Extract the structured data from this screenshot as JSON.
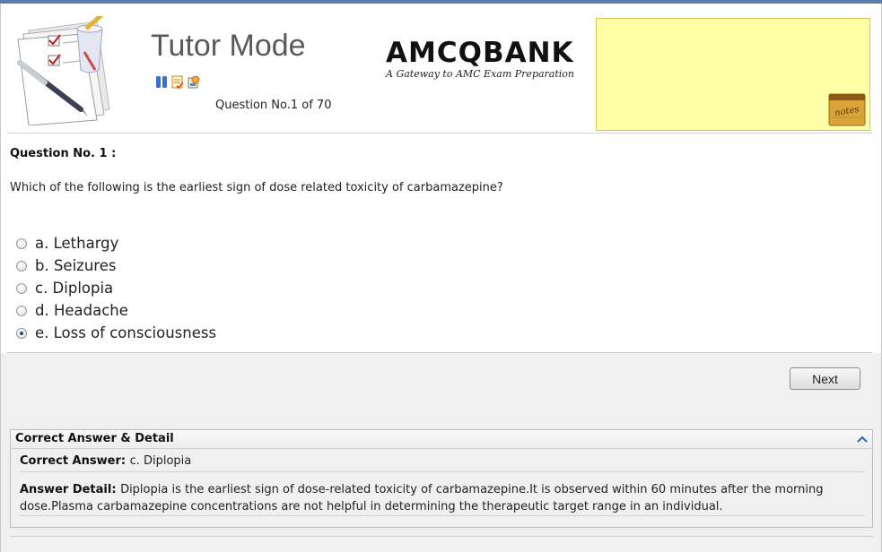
{
  "header": {
    "title": "Tutor Mode",
    "question_counter": "Question No.1 of 70",
    "tools": [
      "pause-icon",
      "review-icon",
      "lab-values-icon"
    ],
    "brand_name": "AMCQBANK",
    "brand_tagline": "A Gateway to AMC Exam Preparation",
    "notes_label": "notes"
  },
  "question": {
    "heading": "Question No. 1 :",
    "text": "Which of the following is the earliest sign of dose related toxicity of carbamazepine?",
    "options": [
      {
        "label": "a. Lethargy",
        "selected": false
      },
      {
        "label": "b. Seizures",
        "selected": false
      },
      {
        "label": "c. Diplopia",
        "selected": false
      },
      {
        "label": "d. Headache",
        "selected": false
      },
      {
        "label": "e. Loss of consciousness",
        "selected": true
      }
    ]
  },
  "navigation": {
    "next_label": "Next"
  },
  "answer_panel": {
    "title": "Correct Answer & Detail",
    "correct_label": "Correct Answer:",
    "correct_value": "c. Diplopia",
    "detail_label": "Answer Detail:",
    "detail_text": "Diplopia is the earliest sign of dose-related toxicity of carbamazepine.It is observed within 60 minutes after the morning dose.Plasma carbamazepine concentrations are not helpful in determining the therapeutic target range in an individual."
  },
  "colors": {
    "accent": "#5b7fa6",
    "notes_bg": "#ffffa6",
    "selected_dot": "#2a4a7a"
  }
}
